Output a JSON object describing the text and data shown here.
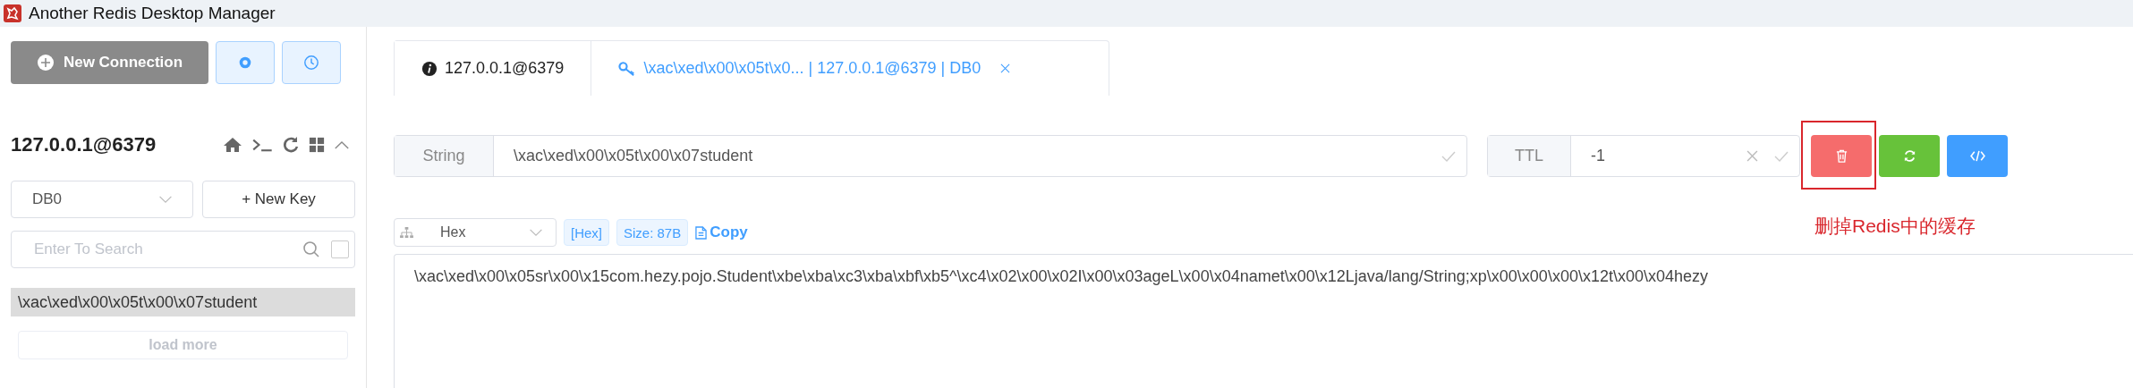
{
  "window": {
    "title": "Another Redis Desktop Manager"
  },
  "sidebar": {
    "new_connection": "New Connection",
    "connection": {
      "name": "127.0.0.1@6379",
      "expanded": true
    },
    "db_select": {
      "value": "DB0"
    },
    "new_key": "+ New Key",
    "search": {
      "placeholder": "Enter To Search",
      "exact_match": false
    },
    "keys": [
      {
        "label": "\\xac\\xed\\x00\\x05t\\x00\\x07student",
        "selected": true
      }
    ],
    "load_more": "load more"
  },
  "tabs": [
    {
      "label": "127.0.0.1@6379",
      "kind": "info",
      "selected": false
    },
    {
      "label": "\\xac\\xed\\x00\\x05t\\x0... | 127.0.0.1@6379 | DB0",
      "kind": "key",
      "selected": true
    }
  ],
  "key_bar": {
    "type": "String",
    "key": "\\xac\\xed\\x00\\x05t\\x00\\x07student",
    "ttl_label": "TTL",
    "ttl": "-1"
  },
  "annotation": {
    "text": "删掉Redis中的缓存"
  },
  "value_toolbar": {
    "format": "Hex",
    "format_tag": "[Hex]",
    "size": "Size: 87B",
    "copy": "Copy"
  },
  "value": "\\xac\\xed\\x00\\x05sr\\x00\\x15com.hezy.pojo.Student\\xbe\\xba\\xc3\\xba\\xbf\\xb5^\\xc4\\x02\\x00\\x02I\\x00\\x03ageL\\x00\\x04namet\\x00\\x12Ljava/lang/String;xp\\x00\\x00\\x00\\x12t\\x00\\x04hezy"
}
